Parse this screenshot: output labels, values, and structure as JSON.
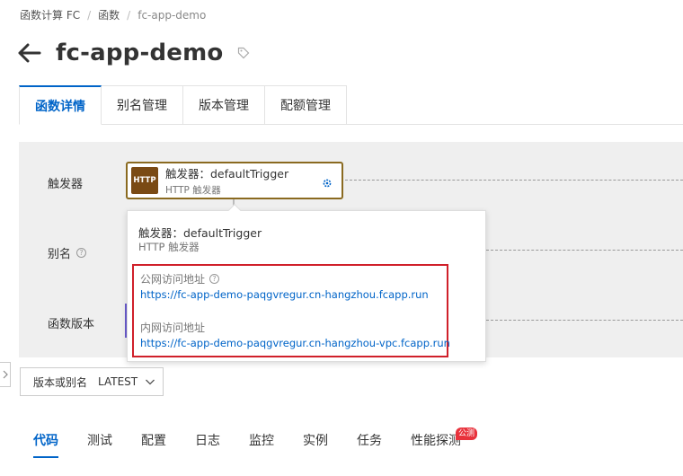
{
  "breadcrumb": {
    "root": "函数计算 FC",
    "level2": "函数",
    "current": "fc-app-demo"
  },
  "function_name": "fc-app-demo",
  "tabs": [
    {
      "label": "函数详情"
    },
    {
      "label": "别名管理"
    },
    {
      "label": "版本管理"
    },
    {
      "label": "配额管理"
    }
  ],
  "graph": {
    "row_trigger": "触发器",
    "row_alias": "别名",
    "row_version": "函数版本",
    "trigger_node": {
      "badge": "HTTP",
      "name": "触发器：defaultTrigger",
      "type": "HTTP 触发器"
    }
  },
  "popover": {
    "name": "触发器：defaultTrigger",
    "type": "HTTP 触发器",
    "public_label": "公网访问地址",
    "public_url": "https://fc-app-demo-paqgvregur.cn-hangzhou.fcapp.run",
    "internal_label": "内网访问地址",
    "internal_url": "https://fc-app-demo-paqgvregur.cn-hangzhou-vpc.fcapp.run"
  },
  "version_select": {
    "label": "版本或别名",
    "value": "LATEST"
  },
  "subtabs": [
    {
      "label": "代码"
    },
    {
      "label": "测试"
    },
    {
      "label": "配置"
    },
    {
      "label": "日志"
    },
    {
      "label": "监控"
    },
    {
      "label": "实例"
    },
    {
      "label": "任务"
    },
    {
      "label": "性能探测",
      "badge": "公测"
    }
  ],
  "colors": {
    "accent": "#0064c8",
    "highlight_border": "#d0202a",
    "trigger_border": "#8a6a20",
    "http_badge": "#7a4a14"
  }
}
